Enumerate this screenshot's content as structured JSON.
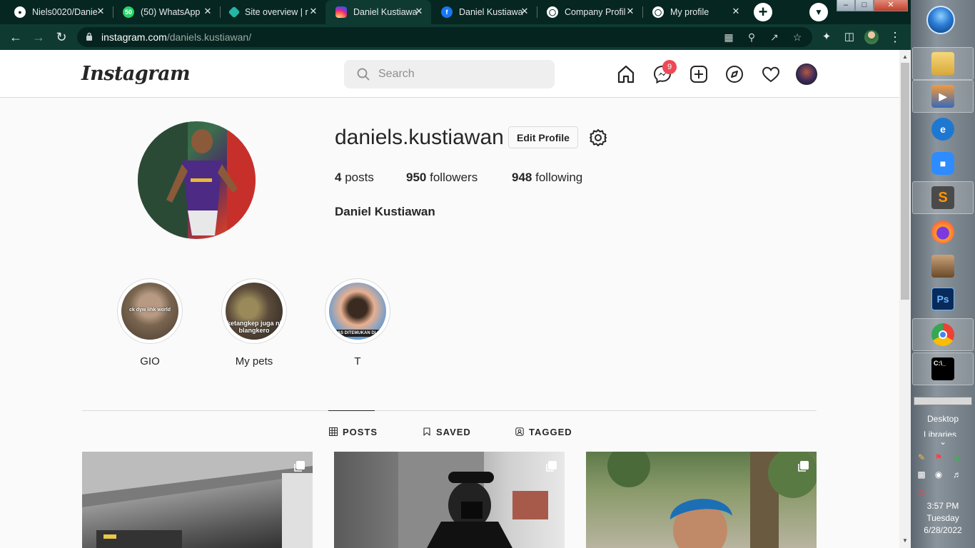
{
  "browser": {
    "tabs": [
      {
        "title": "Niels0020/Danie",
        "favicon": "github-icon"
      },
      {
        "title": "(50) WhatsApp",
        "favicon": "whatsapp-icon"
      },
      {
        "title": "Site overview | r",
        "favicon": "netlify-icon"
      },
      {
        "title": "Daniel Kustiawa",
        "favicon": "instagram-icon",
        "active": true
      },
      {
        "title": "Daniel Kustiawa",
        "favicon": "facebook-icon"
      },
      {
        "title": "Company Profil",
        "favicon": "globe-icon"
      },
      {
        "title": "My profile",
        "favicon": "globe-icon"
      }
    ],
    "url_host": "instagram.com",
    "url_path": "/daniels.kustiawan/"
  },
  "header": {
    "logo": "Instagram",
    "search_placeholder": "Search",
    "messenger_badge": "9"
  },
  "profile": {
    "username": "daniels.kustiawan",
    "edit_label": "Edit Profile",
    "posts_count": "4",
    "posts_label": "posts",
    "followers_count": "950",
    "followers_label": "followers",
    "following_count": "948",
    "following_label": "following",
    "full_name": "Daniel Kustiawan"
  },
  "highlights": [
    {
      "label": "GIO",
      "overlay": "ck dyw lihk world"
    },
    {
      "label": "My pets",
      "overlay": "ketangkep juga ni blangkero"
    },
    {
      "label": "T",
      "overlay": "LEAS DITEMUKAN DI GU"
    }
  ],
  "profile_tabs": [
    {
      "label": "POSTS",
      "icon": "grid-icon",
      "active": true
    },
    {
      "label": "SAVED",
      "icon": "bookmark-icon"
    },
    {
      "label": "TAGGED",
      "icon": "tag-user-icon"
    }
  ],
  "taskbar": {
    "apps": [
      "explorer-icon",
      "media-player-icon",
      "internet-explorer-icon",
      "zoom-icon",
      "sublime-text-icon",
      "firefox-icon",
      "game-icon",
      "photoshop-icon",
      "chrome-icon",
      "cmd-icon"
    ],
    "desktop_label": "Desktop",
    "libraries_label": "Libraries",
    "time": "3:57 PM",
    "day": "Tuesday",
    "date": "6/28/2022"
  },
  "colors": {
    "tabstrip": "#062621",
    "toolbar": "#0e3a32",
    "badge": "#ed4956",
    "text": "#262626"
  }
}
